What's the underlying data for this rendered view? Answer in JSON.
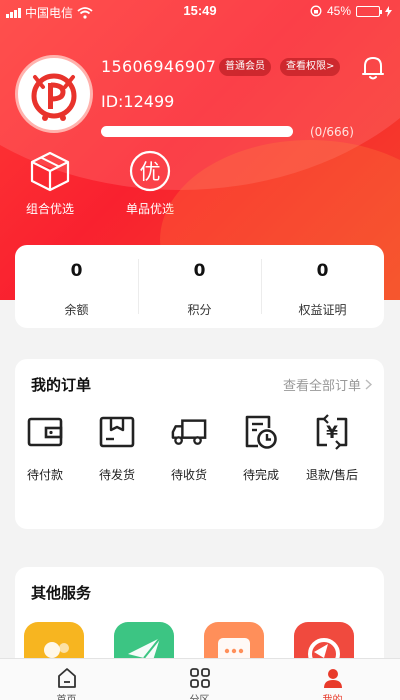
{
  "status_bar": {
    "carrier": "中国电信",
    "time": "15:49",
    "battery": "45%",
    "battery_level": 0.45
  },
  "profile": {
    "phone": "15606946907",
    "member_tag": "普通会员",
    "rights_link": "查看权限>",
    "user_id": "ID:12499",
    "progress_text": "(0/666)",
    "progress_value": 0,
    "progress_max": 666
  },
  "features": [
    {
      "label": "组合优选",
      "icon": "cube-icon"
    },
    {
      "label": "单品优选",
      "icon": "you-badge-icon",
      "glyph": "优"
    }
  ],
  "stats": [
    {
      "value": "0",
      "label": "余额"
    },
    {
      "value": "0",
      "label": "积分"
    },
    {
      "value": "0",
      "label": "权益证明"
    }
  ],
  "orders": {
    "title": "我的订单",
    "view_all": "查看全部订单",
    "items": [
      {
        "label": "待付款",
        "icon": "wallet-icon"
      },
      {
        "label": "待发货",
        "icon": "package-icon"
      },
      {
        "label": "待收货",
        "icon": "truck-icon"
      },
      {
        "label": "待完成",
        "icon": "clock-document-icon"
      },
      {
        "label": "退款/售后",
        "icon": "refund-icon",
        "glyph": "¥"
      }
    ]
  },
  "services": {
    "title": "其他服务",
    "items": [
      {
        "icon": "service-user-icon",
        "color": "#f7b520"
      },
      {
        "icon": "service-send-icon",
        "color": "#3cc583"
      },
      {
        "icon": "service-message-icon",
        "color": "#ff8f5a"
      },
      {
        "icon": "service-support-icon",
        "color": "#f04a3e"
      }
    ]
  },
  "tabs": [
    {
      "label": "首页",
      "icon": "home-icon"
    },
    {
      "label": "分区",
      "icon": "grid-icon"
    },
    {
      "label": "我的",
      "icon": "person-icon",
      "active": true
    }
  ],
  "colors": {
    "primary": "#f7312f",
    "accent_active": "#e83a2a"
  }
}
